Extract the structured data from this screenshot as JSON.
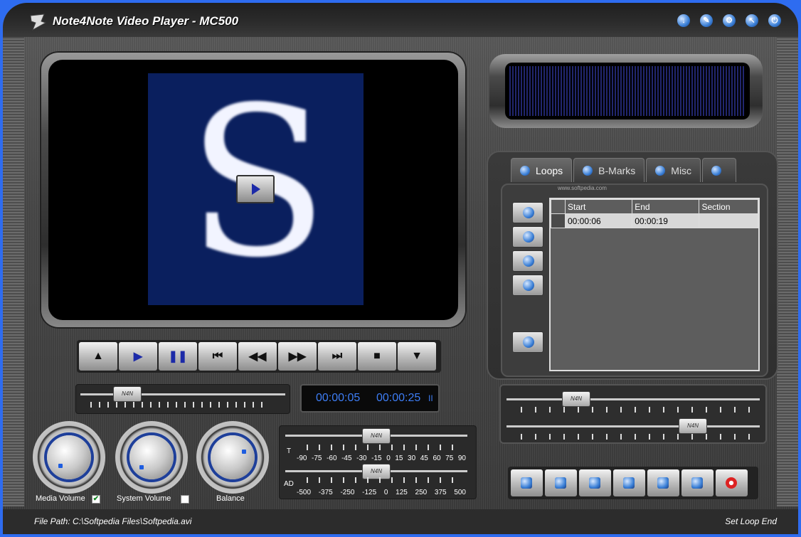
{
  "window": {
    "title": "Note4Note Video Player - MC500"
  },
  "title_icons": [
    "download-icon",
    "edit-icon",
    "settings-icon",
    "pointer-icon",
    "power-icon"
  ],
  "time_display": {
    "current": "00:00:05",
    "total": "00:00:25",
    "state_glyph": "II"
  },
  "transport": {
    "buttons": [
      {
        "name": "eject-button",
        "glyph": "▲"
      },
      {
        "name": "play-button",
        "glyph": "▶"
      },
      {
        "name": "pause-button",
        "glyph": "❚❚"
      },
      {
        "name": "skip-start-button",
        "glyph": "⏮"
      },
      {
        "name": "rewind-button",
        "glyph": "◀◀"
      },
      {
        "name": "fast-forward-button",
        "glyph": "▶▶"
      },
      {
        "name": "skip-end-button",
        "glyph": "⏭"
      },
      {
        "name": "stop-button",
        "glyph": "■"
      },
      {
        "name": "down-button",
        "glyph": "▼"
      }
    ]
  },
  "slider_thumb_label": "N4N",
  "knobs": {
    "media_volume": {
      "label": "Media Volume",
      "checked": true,
      "ticks": [
        "0",
        "10",
        "20",
        "30",
        "40",
        "50",
        "60",
        "70",
        "80",
        "90",
        "100"
      ]
    },
    "system_volume": {
      "label": "System Volume",
      "checked": false,
      "ticks": [
        "0",
        "10",
        "20",
        "30",
        "40",
        "50",
        "60",
        "70",
        "80",
        "90",
        "100"
      ]
    },
    "balance": {
      "label": "Balance",
      "ticks": [
        "-100",
        "-80",
        "-60",
        "-40",
        "-20",
        "0",
        "20",
        "40",
        "60",
        "80",
        "100"
      ]
    }
  },
  "eq": {
    "tempo_label": "T",
    "tempo_scale": [
      "-90",
      "-75",
      "-60",
      "-45",
      "-30",
      "-15",
      "0",
      "15",
      "30",
      "45",
      "60",
      "75",
      "90"
    ],
    "ad_label": "AD",
    "ad_scale": [
      "-500",
      "-375",
      "-250",
      "-125",
      "0",
      "125",
      "250",
      "375",
      "500"
    ]
  },
  "tabs": [
    {
      "label": "Loops",
      "active": true
    },
    {
      "label": "B-Marks",
      "active": false
    },
    {
      "label": "Misc",
      "active": false
    },
    {
      "label": "",
      "active": false
    }
  ],
  "watermark": "www.softpedia.com",
  "loops_table": {
    "columns": [
      "Start",
      "End",
      "Section"
    ],
    "rows": [
      {
        "start": "00:00:06",
        "end": "00:00:19",
        "section": ""
      }
    ]
  },
  "statusbar": {
    "file_path": "File Path: C:\\Softpedia Files\\Softpedia.avi",
    "status": "Set Loop End"
  },
  "colors": {
    "accent_blue": "#3d7df5",
    "window_border": "#2e6cf0",
    "video_bg": "#0a1f5e"
  }
}
